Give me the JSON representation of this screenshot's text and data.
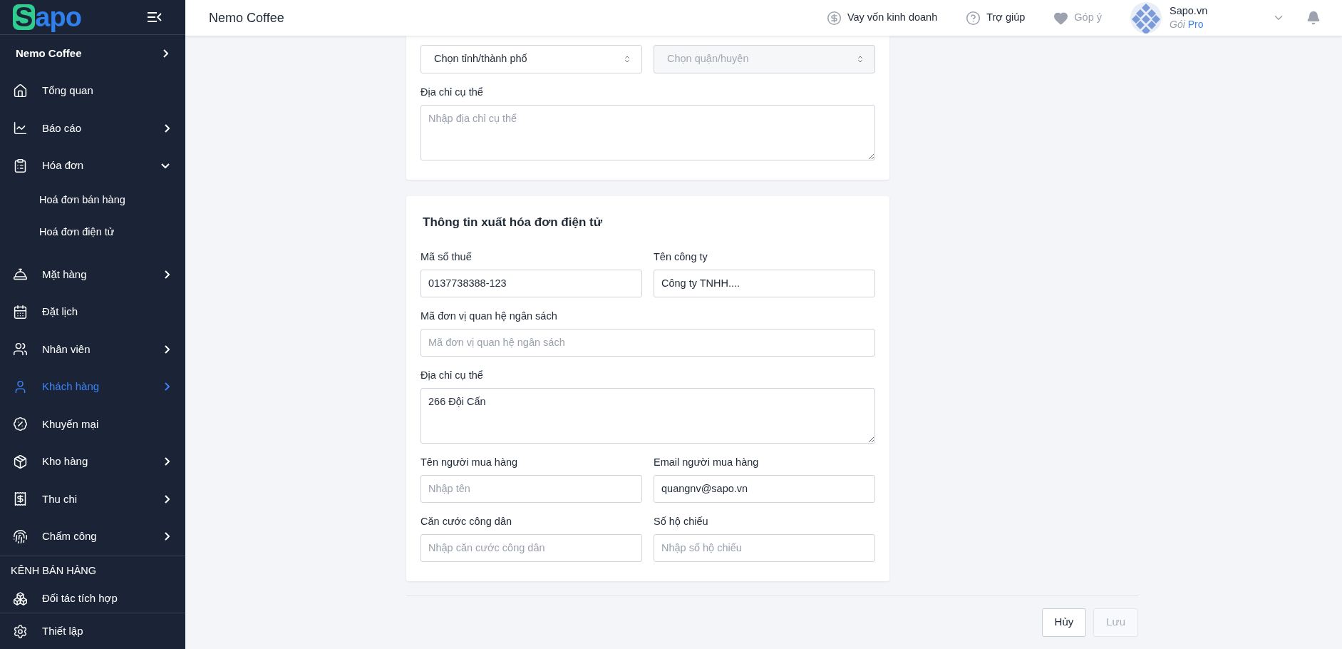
{
  "sidebar": {
    "brand": {
      "first": "S",
      "rest": "apo"
    },
    "store": "Nemo Coffee",
    "items": [
      {
        "label": "Tổng quan",
        "has_arrow": false,
        "selected": false
      },
      {
        "label": "Báo cáo",
        "has_arrow": true,
        "expanded": false,
        "selected": false
      },
      {
        "label": "Hóa đơn",
        "has_arrow": true,
        "expanded": true,
        "selected": false,
        "children": [
          {
            "label": "Hoá đơn bán hàng"
          },
          {
            "label": "Hoá đơn điện tử"
          }
        ]
      },
      {
        "label": "Mặt hàng",
        "has_arrow": true,
        "expanded": false,
        "selected": false
      },
      {
        "label": "Đặt lịch",
        "has_arrow": false,
        "selected": false
      },
      {
        "label": "Nhân viên",
        "has_arrow": true,
        "expanded": false,
        "selected": false
      },
      {
        "label": "Khách hàng",
        "has_arrow": true,
        "expanded": false,
        "selected": true
      },
      {
        "label": "Khuyến mại",
        "has_arrow": false,
        "selected": false
      },
      {
        "label": "Kho hàng",
        "has_arrow": true,
        "expanded": false,
        "selected": false
      },
      {
        "label": "Thu chi",
        "has_arrow": true,
        "expanded": false,
        "selected": false
      },
      {
        "label": "Chấm công",
        "has_arrow": true,
        "expanded": false,
        "selected": false
      }
    ],
    "section_title": "KÊNH BÁN HÀNG",
    "section_items": [
      {
        "label": "Đối tác tích hợp"
      }
    ],
    "footer_item": {
      "label": "Thiết lập"
    }
  },
  "header": {
    "title": "Nemo Coffee",
    "links": [
      {
        "label": "Vay vốn kinh doanh",
        "muted": false
      },
      {
        "label": "Trợ giúp",
        "muted": false
      },
      {
        "label": "Góp ý",
        "muted": true
      }
    ],
    "account": {
      "name": "Sapo.vn",
      "plan_label": "Gói",
      "plan": "Pro"
    }
  },
  "address_card": {
    "rows": [
      [
        {
          "kind": "select",
          "value": "Chọn tỉnh/thành phố",
          "disabled": false
        },
        {
          "kind": "select",
          "value": "Chọn quận/huyện",
          "disabled": true
        }
      ],
      [
        {
          "kind": "textarea",
          "label": "Địa chỉ cụ thể",
          "placeholder": "Nhập địa chỉ cụ thể"
        }
      ]
    ]
  },
  "invoice_card": {
    "title": "Thông tin xuất hóa đơn điện tử",
    "rows": [
      [
        {
          "kind": "text",
          "label": "Mã số thuế",
          "value": "0137738388-123"
        },
        {
          "kind": "text",
          "label": "Tên công ty",
          "value": "Công ty TNHH...."
        }
      ],
      [
        {
          "kind": "text",
          "label": "Mã đơn vị quan hệ ngân sách",
          "placeholder": "Mã đơn vị quan hệ ngân sách"
        }
      ],
      [
        {
          "kind": "textarea",
          "label": "Địa chỉ cụ thể",
          "value": "266 Đội Cấn"
        }
      ],
      [
        {
          "kind": "text",
          "label": "Tên người mua hàng",
          "placeholder": "Nhập tên"
        },
        {
          "kind": "text",
          "label": "Email người mua hàng",
          "value": "quangnv@sapo.vn"
        }
      ],
      [
        {
          "kind": "text",
          "label": "Căn cước công dân",
          "placeholder": "Nhập căn cước công dân"
        },
        {
          "kind": "text",
          "label": "Số hộ chiếu",
          "placeholder": "Nhập số hộ chiếu"
        }
      ]
    ]
  },
  "footer_buttons": [
    {
      "label": "Hủy",
      "disabled": false
    },
    {
      "label": "Lưu",
      "disabled": true
    }
  ]
}
